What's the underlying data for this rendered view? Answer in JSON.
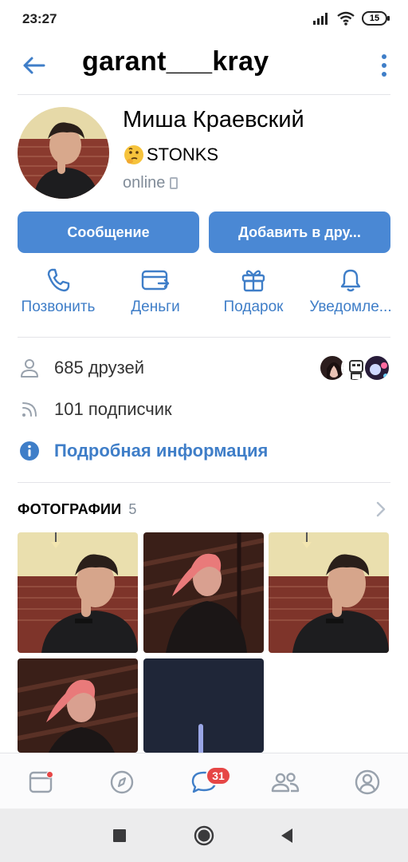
{
  "status_bar": {
    "time": "23:27",
    "battery": "15"
  },
  "header": {
    "title": "garant___kray"
  },
  "profile": {
    "name": "Миша Краевский",
    "status_text": "STONKS",
    "online": "online"
  },
  "buttons": {
    "message": "Сообщение",
    "add_friend": "Добавить в дру..."
  },
  "actions": [
    {
      "label": "Позвонить",
      "icon": "phone-icon"
    },
    {
      "label": "Деньги",
      "icon": "money-icon"
    },
    {
      "label": "Подарок",
      "icon": "gift-icon"
    },
    {
      "label": "Уведомле...",
      "icon": "bell-icon"
    }
  ],
  "info": {
    "friends": "685 друзей",
    "followers": "101 подписчик",
    "details": "Подробная информация"
  },
  "photos": {
    "title": "ФОТОГРАФИИ",
    "count": "5"
  },
  "tabbar": {
    "messages_badge": "31"
  },
  "colors": {
    "accent": "#3f7ec8",
    "button": "#4a88d4",
    "badge": "#e64646",
    "muted": "#818c99"
  }
}
